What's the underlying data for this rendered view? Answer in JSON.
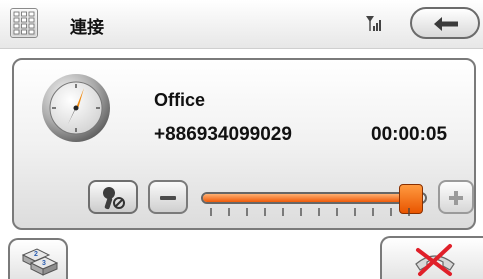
{
  "header": {
    "title": "連接",
    "keypad_icon": "keypad-icon",
    "signal_icon": "signal-icon",
    "back_icon": "back-arrow-icon"
  },
  "call": {
    "contact_name": "Office",
    "number": "+886934099029",
    "duration": "00:00:05",
    "icon": "clock-icon"
  },
  "volume": {
    "level": 0.93,
    "mute_icon": "microphone-mute-icon",
    "decrease_icon": "minus-icon",
    "increase_icon": "plus-icon",
    "accent_color": "#f26a10"
  },
  "footer": {
    "left_icon": "keypad-tiles-icon",
    "right_icon": "hang-up-icon"
  }
}
